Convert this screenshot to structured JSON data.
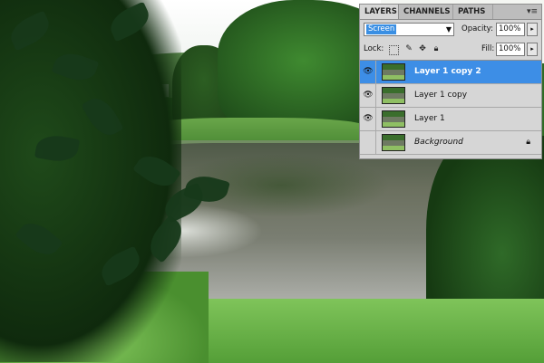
{
  "panel": {
    "tabs": [
      "LAYERS",
      "CHANNELS",
      "PATHS"
    ],
    "blend_mode": "Screen",
    "opacity_label": "Opacity:",
    "opacity_value": "100%",
    "lock_label": "Lock:",
    "fill_label": "Fill:",
    "fill_value": "100%",
    "layers": [
      {
        "name": "Layer 1 copy 2",
        "visible": true,
        "selected": true
      },
      {
        "name": "Layer 1 copy",
        "visible": true,
        "selected": false
      },
      {
        "name": "Layer 1",
        "visible": true,
        "selected": false
      },
      {
        "name": "Background",
        "visible": false,
        "selected": false,
        "locked": true
      }
    ]
  },
  "colors": {
    "selection": "#3d8ee6",
    "panel_bg": "#d6d6d6"
  },
  "icons": [
    "eye-icon",
    "lock-icon",
    "brush-icon",
    "move-icon",
    "panel-menu-icon"
  ]
}
